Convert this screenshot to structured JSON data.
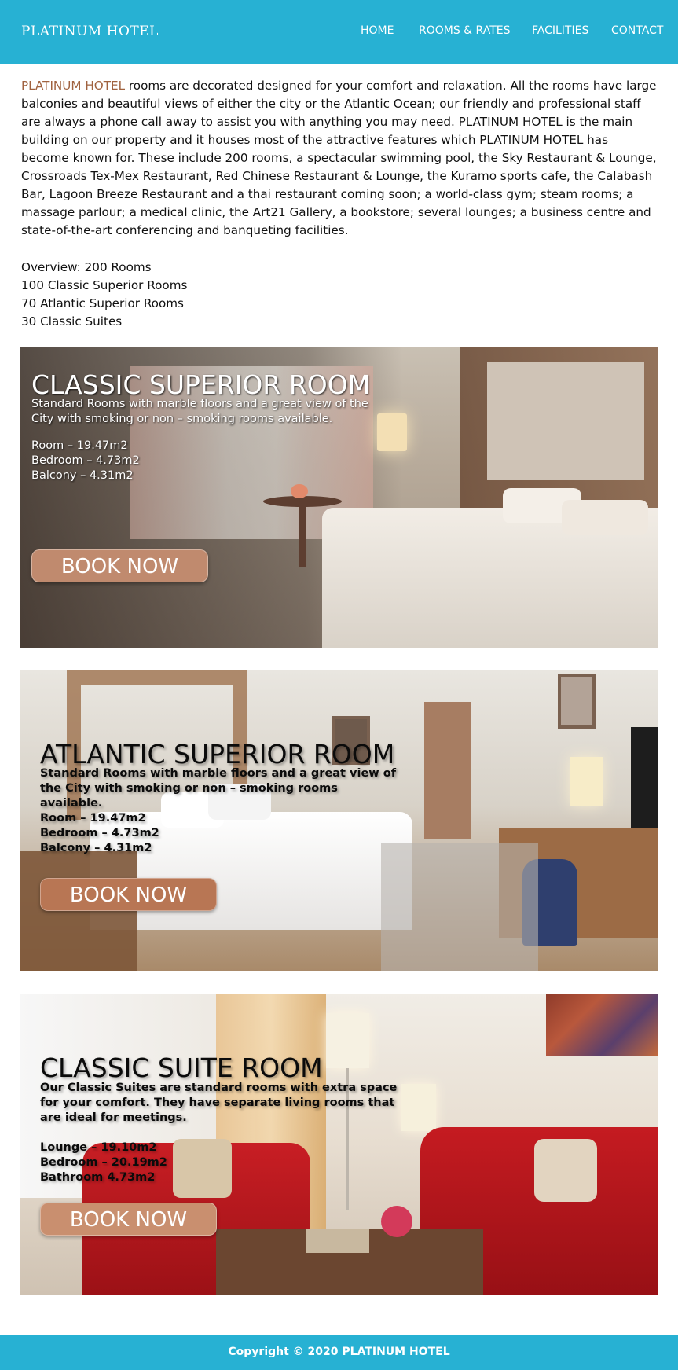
{
  "header": {
    "logo": "PLATINUM HOTEL",
    "nav": [
      "HOME",
      "ROOMS & RATES",
      "FACILITIES",
      "CONTACT"
    ]
  },
  "intro": {
    "brand": "PLATINUM HOTEL",
    "text": " rooms are decorated designed for your comfort and relaxation. All the rooms have large balconies and beautiful views of either the city or the Atlantic Ocean; our friendly and professional staff are always a phone call away to assist you with anything you may need. PLATINUM HOTEL is the main building on our property and it houses most of the attractive features which PLATINUM HOTEL has become known for. These include 200 rooms, a spectacular swimming pool, the Sky Restaurant & Lounge, Crossroads Tex-Mex Restaurant, Red Chinese Restaurant & Lounge, the Kuramo sports cafe, the Calabash Bar, Lagoon Breeze Restaurant and a thai restaurant coming soon; a world-class gym; steam rooms; a massage parlour; a medical clinic, the Art21 Gallery, a bookstore; several lounges; a business centre and state-of-the-art conferencing and banqueting facilities."
  },
  "overview": [
    "Overview: 200 Rooms",
    "100 Classic Superior Rooms",
    "70 Atlantic Superior Rooms",
    "30 Classic Suites"
  ],
  "rooms": [
    {
      "title": "CLASSIC SUPERIOR ROOM",
      "desc": "Standard Rooms with marble floors and a great view of the City with smoking or non – smoking rooms available.",
      "specs": [
        "Room – 19.47m2",
        "Bedroom – 4.73m2",
        "Balcony – 4.31m2"
      ],
      "button": "BOOK NOW"
    },
    {
      "title": "ATLANTIC SUPERIOR ROOM",
      "desc": "Standard Rooms with marble floors and a great view of the City with smoking or non – smoking rooms available.",
      "specs": [
        "Room – 19.47m2",
        "Bedroom – 4.73m2",
        "Balcony – 4.31m2"
      ],
      "button": "BOOK NOW"
    },
    {
      "title": "CLASSIC SUITE ROOM",
      "desc": "Our Classic Suites are standard rooms with extra space for your comfort. They have separate living rooms that are ideal for meetings.",
      "specs": [
        "Lounge – 19.10m2",
        "Bedroom – 20.19m2",
        "Bathroom 4.73m2"
      ],
      "button": "BOOK NOW"
    }
  ],
  "footer": {
    "copyright": "Copyright © 2020 PLATINUM HOTEL"
  },
  "colors": {
    "header_bg": "#27b1d3",
    "brand_accent": "#a0623f",
    "button_bg": "#c08a6e"
  }
}
